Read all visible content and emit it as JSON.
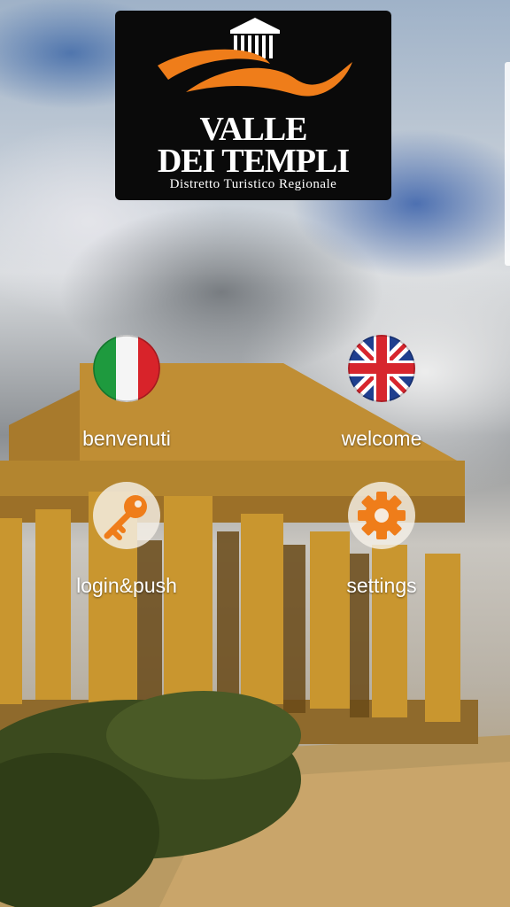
{
  "logo": {
    "line1": "VALLE",
    "line2": "DEI TEMPLI",
    "subtitle": "Distretto Turistico Regionale"
  },
  "menu": {
    "benvenuti": {
      "label": "benvenuti",
      "icon": "italian-flag-icon"
    },
    "welcome": {
      "label": "welcome",
      "icon": "uk-flag-icon"
    },
    "login": {
      "label": "login&push",
      "icon": "key-icon"
    },
    "settings": {
      "label": "settings",
      "icon": "gear-icon"
    }
  },
  "colors": {
    "accent": "#ef7d1a",
    "logo_bg": "#0a0a0a",
    "italy_green": "#1e9a3e",
    "italy_red": "#d8232a",
    "uk_blue": "#1f3f8f",
    "uk_red": "#d7262e"
  }
}
